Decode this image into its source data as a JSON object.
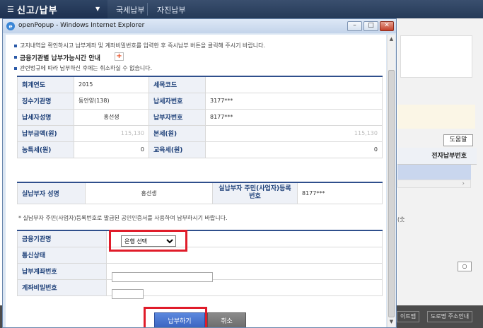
{
  "nav": {
    "menu_label": "신고/납부",
    "crumbs": [
      "국세납부",
      "자진납부"
    ]
  },
  "background": {
    "help_button": "도움말",
    "column_header": "전자납부번호",
    "bracket_text": "(숫",
    "footer_links": [
      "이트맵",
      "도로명 주소안내"
    ]
  },
  "window": {
    "title": "openPopup - Windows Internet Explorer",
    "buttons": [
      "–",
      "□",
      "✕"
    ]
  },
  "notes": {
    "line1": "고지내역을 확인하시고 납부계좌 및 계좌비밀번호를 입력한 후 즉시납부 버튼을 클릭해 주시기 바랍니다.",
    "bank_hours_link": "금융기관별 납부가능시간 안내",
    "line3": "관련법규에 따라 납부하신 후에는 취소하실 수 없습니다.",
    "cert_note": "* 실납부자 주민(사업자)등록번호로 발급된 공인인증서를 사용하여 납부하시기 바랍니다."
  },
  "bill": {
    "fiscal_year_label": "회계연도",
    "fiscal_year": "2015",
    "tax_code_label": "세목코드",
    "tax_code": "",
    "office_label": "징수기관명",
    "office": "동안양(138)",
    "taxpayer_no_label": "납세자번호",
    "taxpayer_no": "3177***",
    "taxpayer_name_label": "납세자성명",
    "taxpayer_name": "홍선생",
    "payer_no_label": "납부자번호",
    "payer_no": "8177***",
    "amount_label": "납부금액(원)",
    "amount": "115,130",
    "main_tax_label": "본세(원)",
    "main_tax": "115,130",
    "rural_tax_label": "농특세(원)",
    "rural_tax": "0",
    "edu_tax_label": "교육세(원)",
    "edu_tax": "0"
  },
  "actual_payer": {
    "name_label": "실납부자 성명",
    "name": "홍선생",
    "id_label": "실납부자 주민(사업자)등록번호",
    "id": "8177***"
  },
  "form": {
    "bank_label": "금융기관명",
    "bank_selected": "은행 선택",
    "status_label": "통신상태",
    "account_label": "납부계좌번호",
    "password_label": "계좌비밀번호"
  },
  "actions": {
    "pay": "납부하기",
    "cancel": "취소"
  }
}
